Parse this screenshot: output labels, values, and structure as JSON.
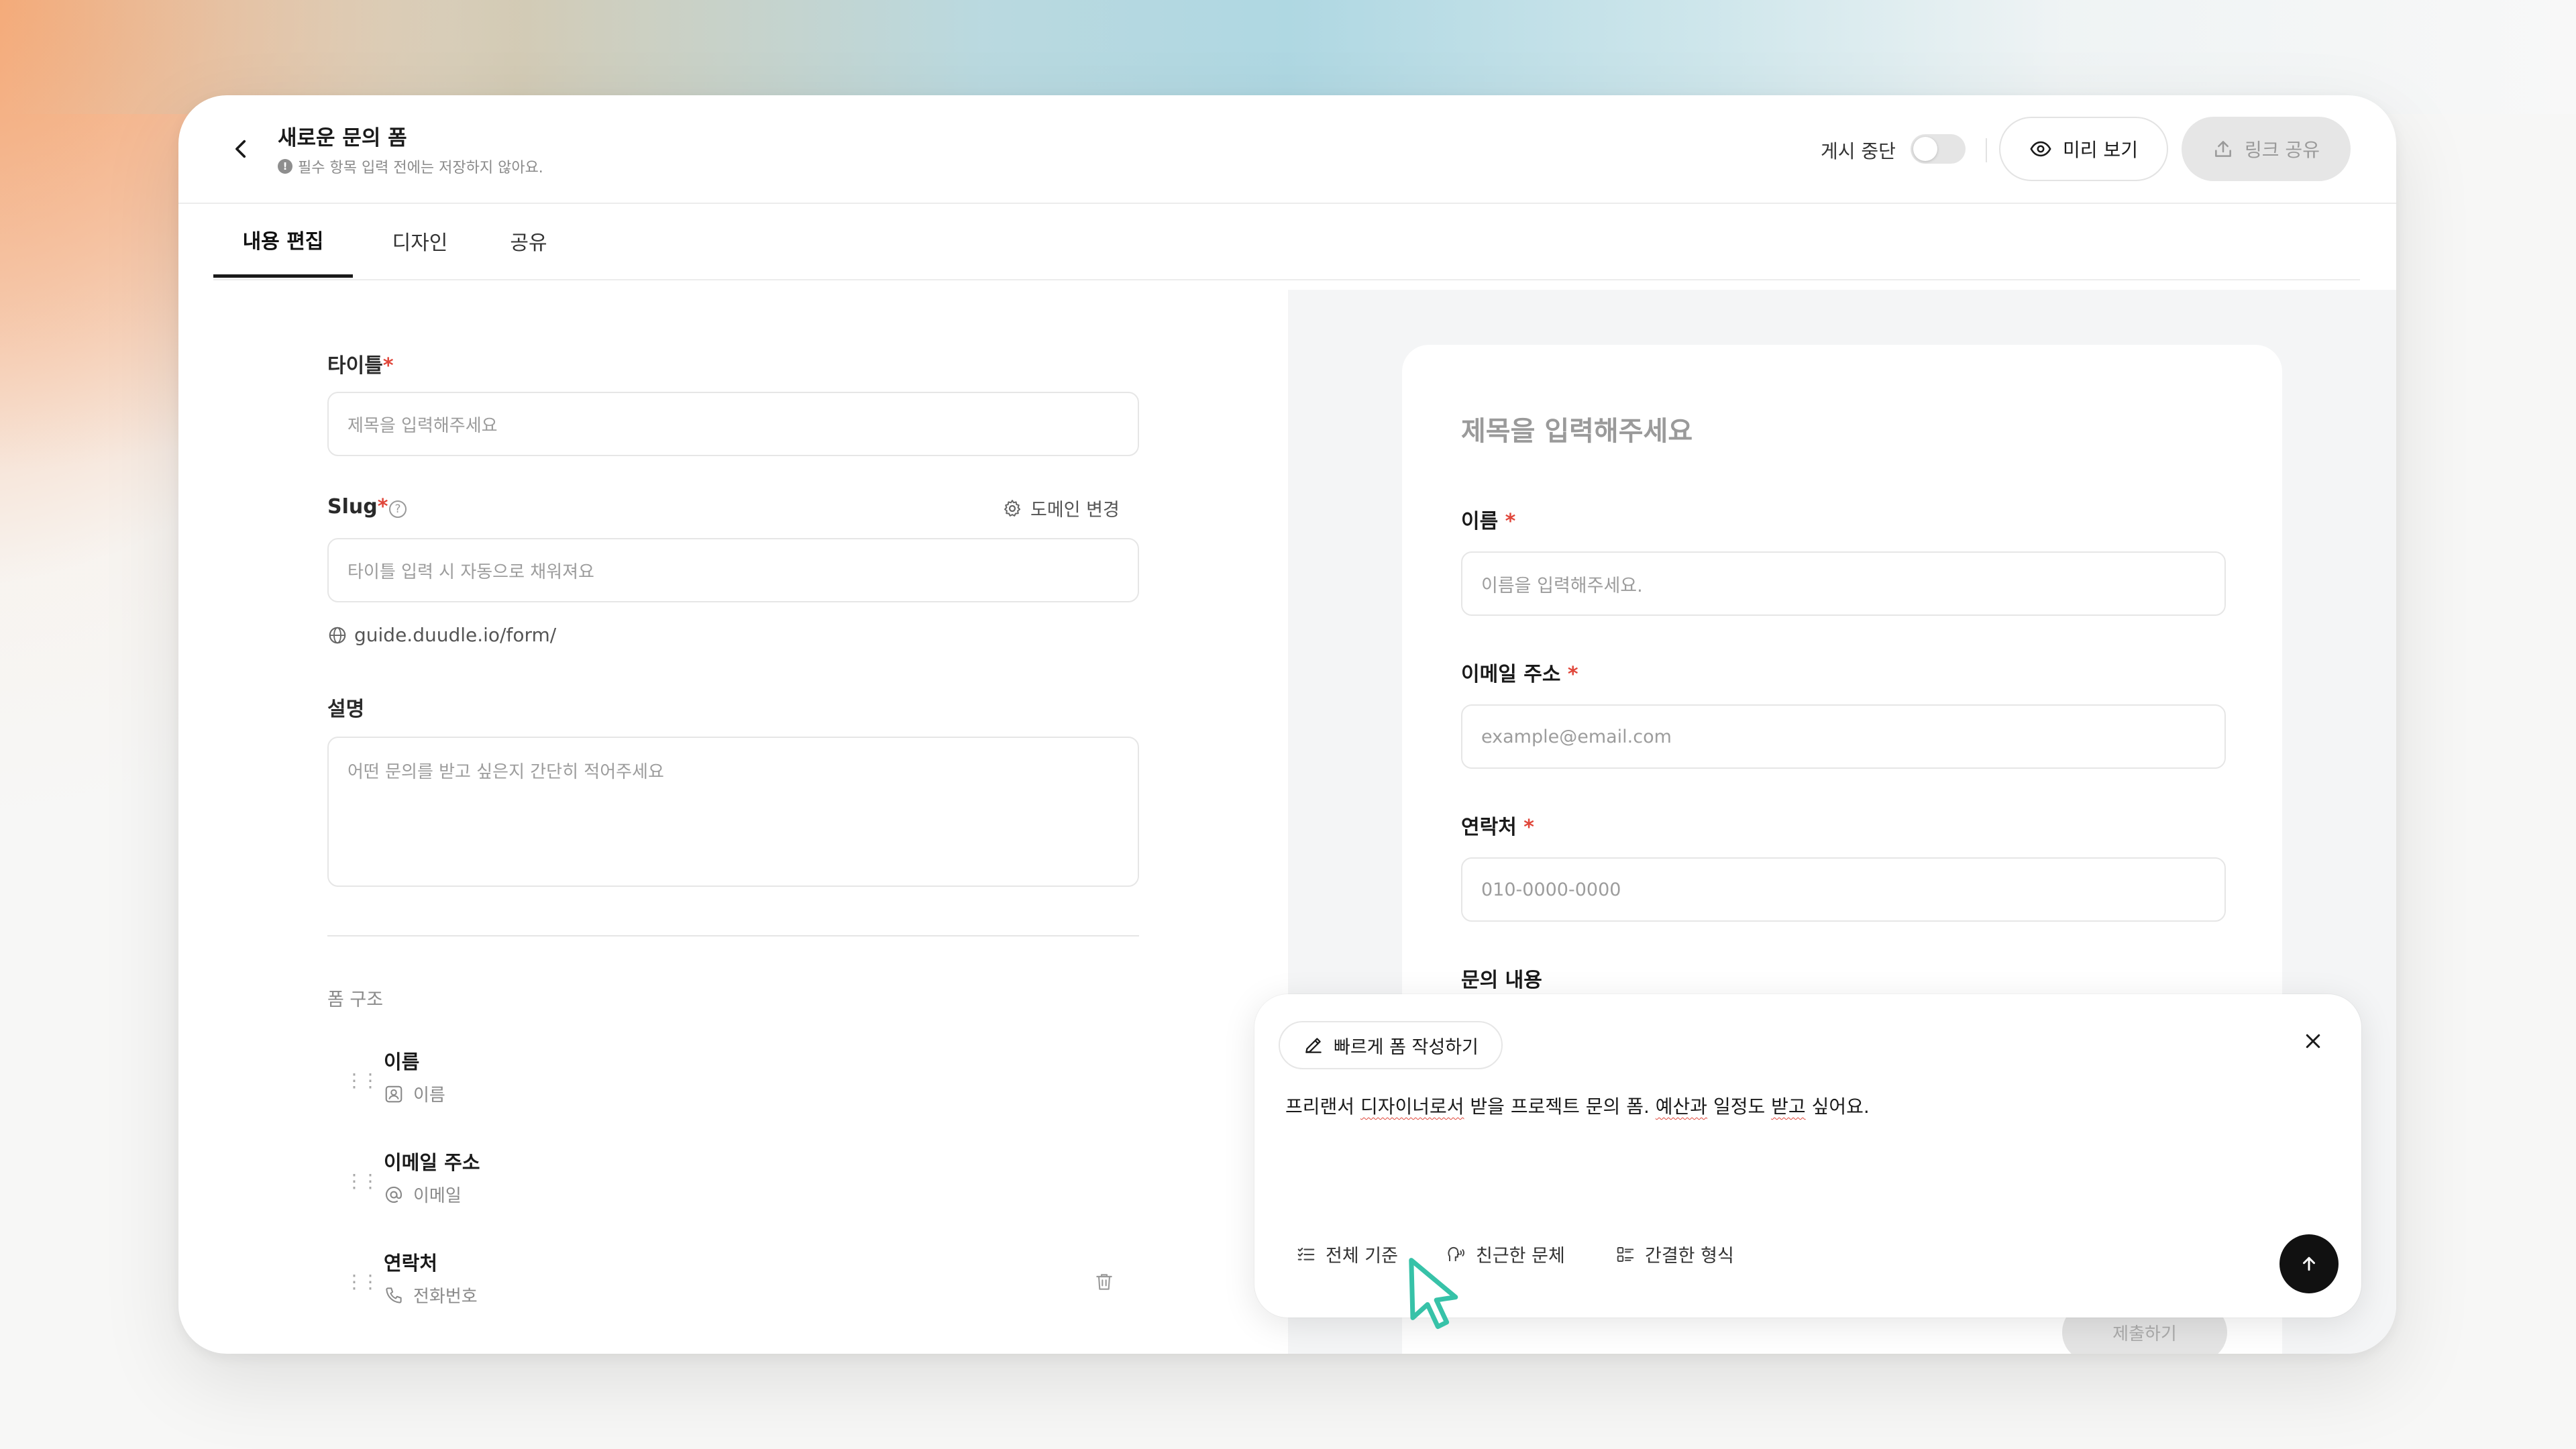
{
  "header": {
    "title": "새로운 문의 폼",
    "subtitle": "필수 항목 입력 전에는 저장하지 않아요.",
    "pause_label": "게시 중단",
    "preview_label": "미리 보기",
    "share_label": "링크 공유"
  },
  "tabs": [
    "내용 편집",
    "디자인",
    "공유"
  ],
  "editor": {
    "title_label": "타이틀",
    "title_placeholder": "제목을 입력해주세요",
    "slug_label": "Slug",
    "domain_change": "도메인 변경",
    "slug_placeholder": "타이틀 입력 시 자동으로 채워져요",
    "url_prefix": "guide.duudle.io/form/",
    "desc_label": "설명",
    "desc_placeholder": "어떤 문의를 받고 싶은지 간단히 적어주세요",
    "structure_label": "폼 구조",
    "structure": [
      {
        "title": "이름",
        "type": "이름",
        "icon": "user-card-icon"
      },
      {
        "title": "이메일 주소",
        "type": "이메일",
        "icon": "at-icon"
      },
      {
        "title": "연락처",
        "type": "전화번호",
        "icon": "phone-icon"
      }
    ]
  },
  "preview": {
    "title": "제목을 입력해주세요",
    "fields": [
      {
        "label": "이름",
        "placeholder": "이름을 입력해주세요."
      },
      {
        "label": "이메일 주소",
        "placeholder": "example@email.com"
      },
      {
        "label": "연락처",
        "placeholder": "010-0000-0000"
      }
    ],
    "inquiry_label": "문의 내용",
    "submit_label": "제출하기"
  },
  "quick_compose": {
    "chip_label": "빠르게 폼 작성하기",
    "prompt_parts": [
      "프리랜서 ",
      "디자이너로서",
      " 받을 프로젝트 문의 폼. ",
      "예산과",
      " 일정도 ",
      "받고",
      " 싶어요."
    ],
    "options": [
      "전체 기준",
      "친근한 문체",
      "간결한 형식"
    ]
  },
  "colors": {
    "accent_required": "#e0463a",
    "send_button": "#111111",
    "cursor": "#37c2a8"
  }
}
